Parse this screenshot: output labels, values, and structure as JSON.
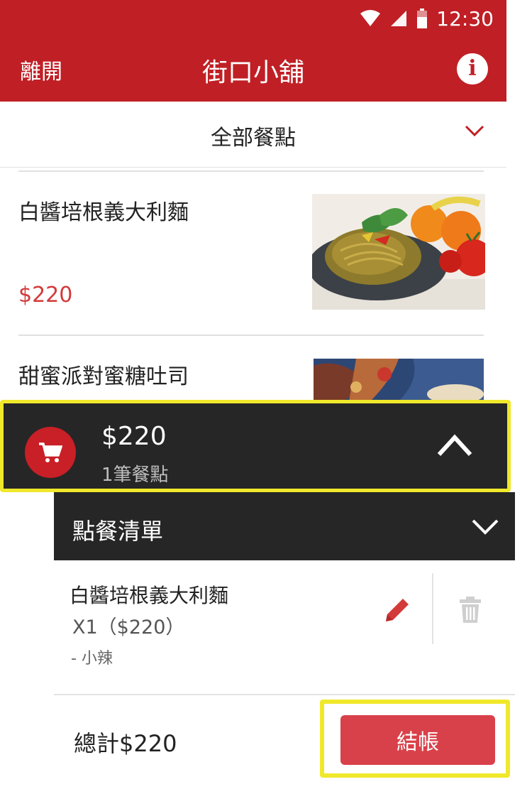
{
  "status_bar": {
    "time": "12:30"
  },
  "topbar": {
    "leave_label": "離開",
    "title": "街口小舖"
  },
  "category": {
    "selected": "全部餐點"
  },
  "menu_items": [
    {
      "name": "白醬培根義大利麵",
      "price": "$220"
    },
    {
      "name": "甜蜜派對蜜糖吐司"
    }
  ],
  "cart": {
    "amount": "$220",
    "count": "1筆餐點"
  },
  "order": {
    "title": "點餐清單",
    "item": {
      "name": "白醬培根義大利麵",
      "qty": "X1（$220）",
      "note": "- 小辣"
    },
    "total": "總計$220",
    "checkout_label": "結帳"
  },
  "colors": {
    "brand_red": "#c01f25",
    "price_red": "#d33a3a",
    "panel_dark": "#262626",
    "highlight_yellow": "#f0e82a",
    "checkout_red": "#d9414a"
  },
  "icons": [
    "wifi-icon",
    "signal-icon",
    "battery-icon",
    "info-icon",
    "chevron-down-icon",
    "cart-icon",
    "chevron-up-icon",
    "pencil-icon",
    "trash-icon"
  ]
}
